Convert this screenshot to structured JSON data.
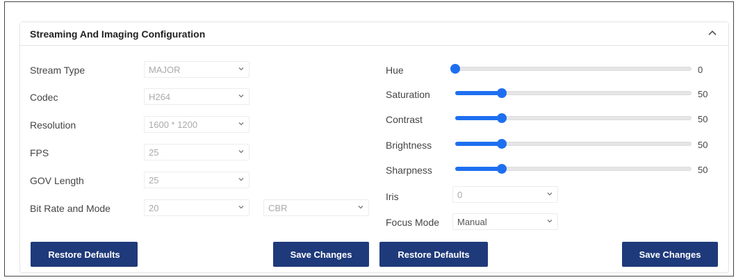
{
  "panel": {
    "title": "Streaming And Imaging Configuration"
  },
  "stream": {
    "fields": [
      {
        "label": "Stream Type",
        "value": "MAJOR"
      },
      {
        "label": "Codec",
        "value": "H264"
      },
      {
        "label": "Resolution",
        "value": "1600 * 1200"
      },
      {
        "label": "FPS",
        "value": "25"
      },
      {
        "label": "GOV Length",
        "value": "25"
      },
      {
        "label": "Bit Rate and Mode",
        "value": "20",
        "mode": "CBR"
      }
    ],
    "restore_label": "Restore Defaults",
    "save_label": "Save Changes"
  },
  "imaging": {
    "sliders": [
      {
        "label": "Hue",
        "value": 0,
        "display": "0"
      },
      {
        "label": "Saturation",
        "value": 50,
        "display": "50"
      },
      {
        "label": "Contrast",
        "value": 50,
        "display": "50"
      },
      {
        "label": "Brightness",
        "value": 50,
        "display": "50"
      },
      {
        "label": "Sharpness",
        "value": 50,
        "display": "50"
      }
    ],
    "iris": {
      "label": "Iris",
      "value": "0"
    },
    "focus": {
      "label": "Focus Mode",
      "value": "Manual"
    },
    "restore_label": "Restore Defaults",
    "save_label": "Save Changes"
  },
  "colors": {
    "accent": "#1e6ff0",
    "button": "#1f3a7a"
  },
  "icons": {
    "collapse": "chevron-up-icon",
    "dropdown": "chevron-down-icon"
  }
}
